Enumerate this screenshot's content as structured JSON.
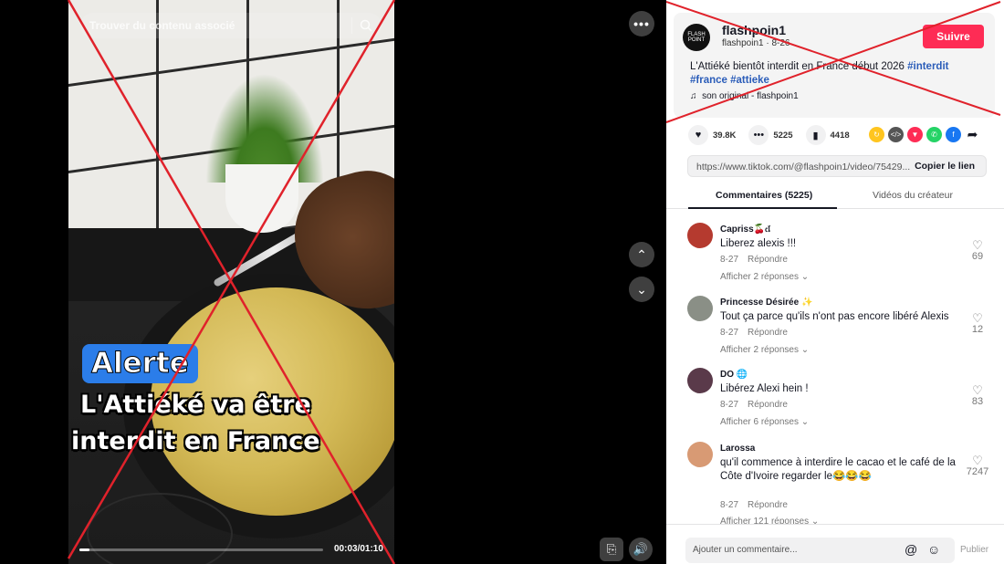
{
  "video": {
    "search_placeholder": "Trouver du contenu associé",
    "overlay_alert": "Alerte",
    "overlay_line1": "L'Attiéké va être",
    "overlay_line2": "interdit en France",
    "time": "00:03/01:10",
    "progress_fraction": 0.043,
    "more_label": "•••",
    "up_label": "⌃",
    "down_label": "⌄",
    "cast_label": "⎘",
    "volume_label": "🔊"
  },
  "post": {
    "avatar_text": "FLASH POINT",
    "username": "flashpoin1",
    "submeta": "flashpoin1 · 8-26",
    "follow_label": "Suivre",
    "caption_text": "L'Attiéké bientôt interdit en France début 2026 ",
    "tags": [
      "#interdit",
      "#france",
      "#attieke"
    ],
    "music_icon": "♫",
    "music": "son original - flashpoin1"
  },
  "actions": {
    "likes": "39.8K",
    "comments": "5225",
    "saves": "4418"
  },
  "share_icons": [
    {
      "name": "repost-icon",
      "glyph": "↻",
      "color": "#ffc51f"
    },
    {
      "name": "embed-icon",
      "glyph": "</>",
      "color": "#555555"
    },
    {
      "name": "send-icon",
      "glyph": "▼",
      "color": "#fe2c55"
    },
    {
      "name": "whatsapp-icon",
      "glyph": "✆",
      "color": "#25d366"
    },
    {
      "name": "facebook-icon",
      "glyph": "f",
      "color": "#1877f2"
    }
  ],
  "link": {
    "url": "https://www.tiktok.com/@flashpoin1/video/75429...",
    "copy_label": "Copier le lien"
  },
  "tabs": {
    "comments": "Commentaires (5225)",
    "creator": "Vidéos du créateur"
  },
  "comments": [
    {
      "user": "Capriss🍒𝔠𝔩",
      "text": "Liberez alexis !!!",
      "date": "8-27",
      "reply": "Répondre",
      "more": "Afficher 2 réponses ⌄",
      "likes": "69",
      "avatar_color": "#b53a2f"
    },
    {
      "user": "Princesse Désirée ✨",
      "text": "Tout ça parce qu'ils n'ont pas encore libéré Alexis",
      "date": "8-27",
      "reply": "Répondre",
      "more": "Afficher 2 réponses ⌄",
      "likes": "12",
      "avatar_color": "#8a8f86"
    },
    {
      "user": "DO 🌐",
      "text": "Libérez Alexi hein !",
      "date": "8-27",
      "reply": "Répondre",
      "more": "Afficher 6 réponses ⌄",
      "likes": "83",
      "avatar_color": "#5a3a4a"
    },
    {
      "user": "Larossa",
      "text": "qu'il commence à interdire le cacao et le café de la Côte d'Ivoire regarder le😂😂😂",
      "date": "8-27",
      "reply": "Répondre",
      "more": "Afficher 121 réponses ⌄",
      "likes": "7247",
      "avatar_color": "#d89a74"
    }
  ],
  "comment_bar": {
    "placeholder": "Ajouter un commentaire...",
    "at_icon": "@",
    "emoji_icon": "☺",
    "publish_label": "Publier"
  },
  "colors": {
    "brand_red": "#fe2c55",
    "hashtag": "#2b5db9",
    "alert_blue": "#2b7de9",
    "annotation_red": "#e0222b"
  }
}
